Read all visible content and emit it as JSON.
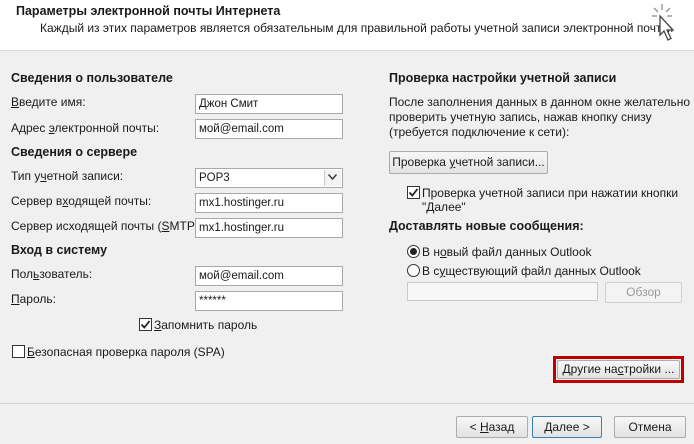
{
  "header": {
    "title": "Параметры электронной почты Интернета",
    "subtitle": "Каждый из этих параметров является обязательным для правильной работы учетной записи электронной почты."
  },
  "user_info": {
    "heading": "Сведения о пользователе",
    "name_label": "Введите имя:",
    "name_value": "Джон Смит",
    "email_label": "Адрес электронной почты:",
    "email_value": "мой@email.com"
  },
  "server_info": {
    "heading": "Сведения о сервере",
    "account_type_label": "Тип учетной записи:",
    "account_type_value": "POP3",
    "incoming_label": "Сервер входящей почты:",
    "incoming_value": "mx1.hostinger.ru",
    "outgoing_label": "Сервер исходящей почты (SMTP):",
    "outgoing_value": "mx1.hostinger.ru"
  },
  "login": {
    "heading": "Вход в систему",
    "user_label": "Пользователь:",
    "user_value": "мой@email.com",
    "password_label": "Пароль:",
    "password_value": "******",
    "remember_label": "Запомнить пароль",
    "remember_checked": true,
    "spa_label": "Безопасная проверка пароля (SPA)",
    "spa_checked": false
  },
  "test": {
    "heading": "Проверка настройки учетной записи",
    "description": [
      "После заполнения данных в данном окне желательно",
      "проверить учетную запись, нажав кнопку снизу",
      "(требуется подключение к сети):"
    ],
    "test_button": "Проверка учетной записи...",
    "auto_test_label": [
      "Проверка учетной записи при нажатии кнопки",
      "\"Далее\""
    ],
    "auto_test_checked": true
  },
  "deliver": {
    "heading": "Доставлять новые сообщения:",
    "option_new": "В новый файл данных Outlook",
    "option_existing": "В существующий файл данных Outlook",
    "selected": "new",
    "path_value": "",
    "browse_button": "Обзор"
  },
  "buttons": {
    "more_settings": "Другие настройки ...",
    "back": "< Назад",
    "next": "Далее >",
    "cancel": "Отмена"
  },
  "colors": {
    "highlight": "#c00000"
  },
  "icons": {
    "cursor": "hand-pointer-cursor-icon"
  }
}
